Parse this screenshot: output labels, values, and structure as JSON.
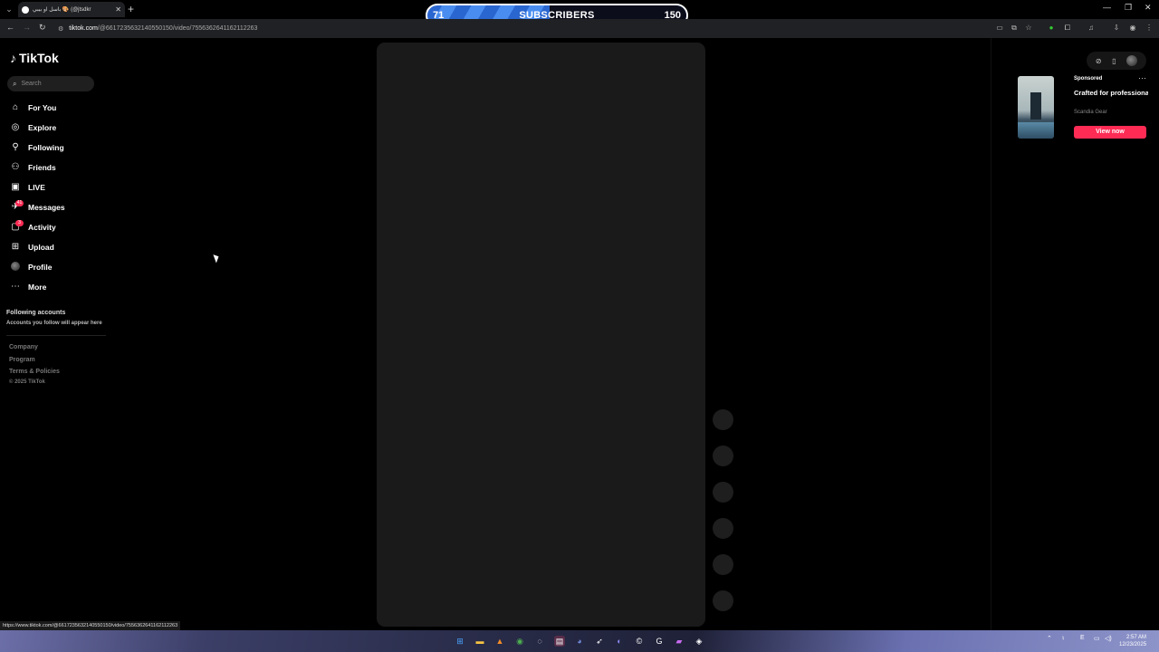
{
  "browser": {
    "tab_title": "باسل او بيبي 🎨 (@jtsdkr",
    "new_tab_label": "+",
    "url_host": "tiktok.com",
    "url_path": "/@661723563214055015​0/video/7556362641162112263",
    "status_url": "https://www.tiktok.com/@66172356321405501​50/video/7556362641162112263"
  },
  "subscriber_widget": {
    "current": "71",
    "label": "SUBSCRIBERS",
    "goal": "150",
    "progress_fraction": 0.473,
    "accent": "#2a66d0"
  },
  "tiktok": {
    "logo_text": "TikTok",
    "search_placeholder": "Search",
    "nav": [
      {
        "label": "For You",
        "icon": "home-icon"
      },
      {
        "label": "Explore",
        "icon": "compass-icon"
      },
      {
        "label": "Following",
        "icon": "user-follow-icon"
      },
      {
        "label": "Friends",
        "icon": "friends-icon"
      },
      {
        "label": "LIVE",
        "icon": "live-icon"
      },
      {
        "label": "Messages",
        "icon": "messages-icon",
        "badge": "41"
      },
      {
        "label": "Activity",
        "icon": "activity-icon",
        "badge": "3"
      },
      {
        "label": "Upload",
        "icon": "upload-icon"
      },
      {
        "label": "Profile",
        "icon": "avatar"
      },
      {
        "label": "More",
        "icon": "more-icon"
      }
    ],
    "following_title": "Following accounts",
    "following_sub": "Accounts you follow will appear here",
    "footer": [
      "Company",
      "Program",
      "Terms & Policies"
    ],
    "copyright": "© 2025 TikTok",
    "brand_color": "#fe2c55"
  },
  "ad": {
    "sponsored": "Sponsored",
    "title": "Crafted for professionals operati...",
    "brand": "Scandia Gear",
    "cta": "View now"
  },
  "taskbar": {
    "time": "2:57 AM",
    "date": "12/23/2025",
    "lang": "E"
  }
}
